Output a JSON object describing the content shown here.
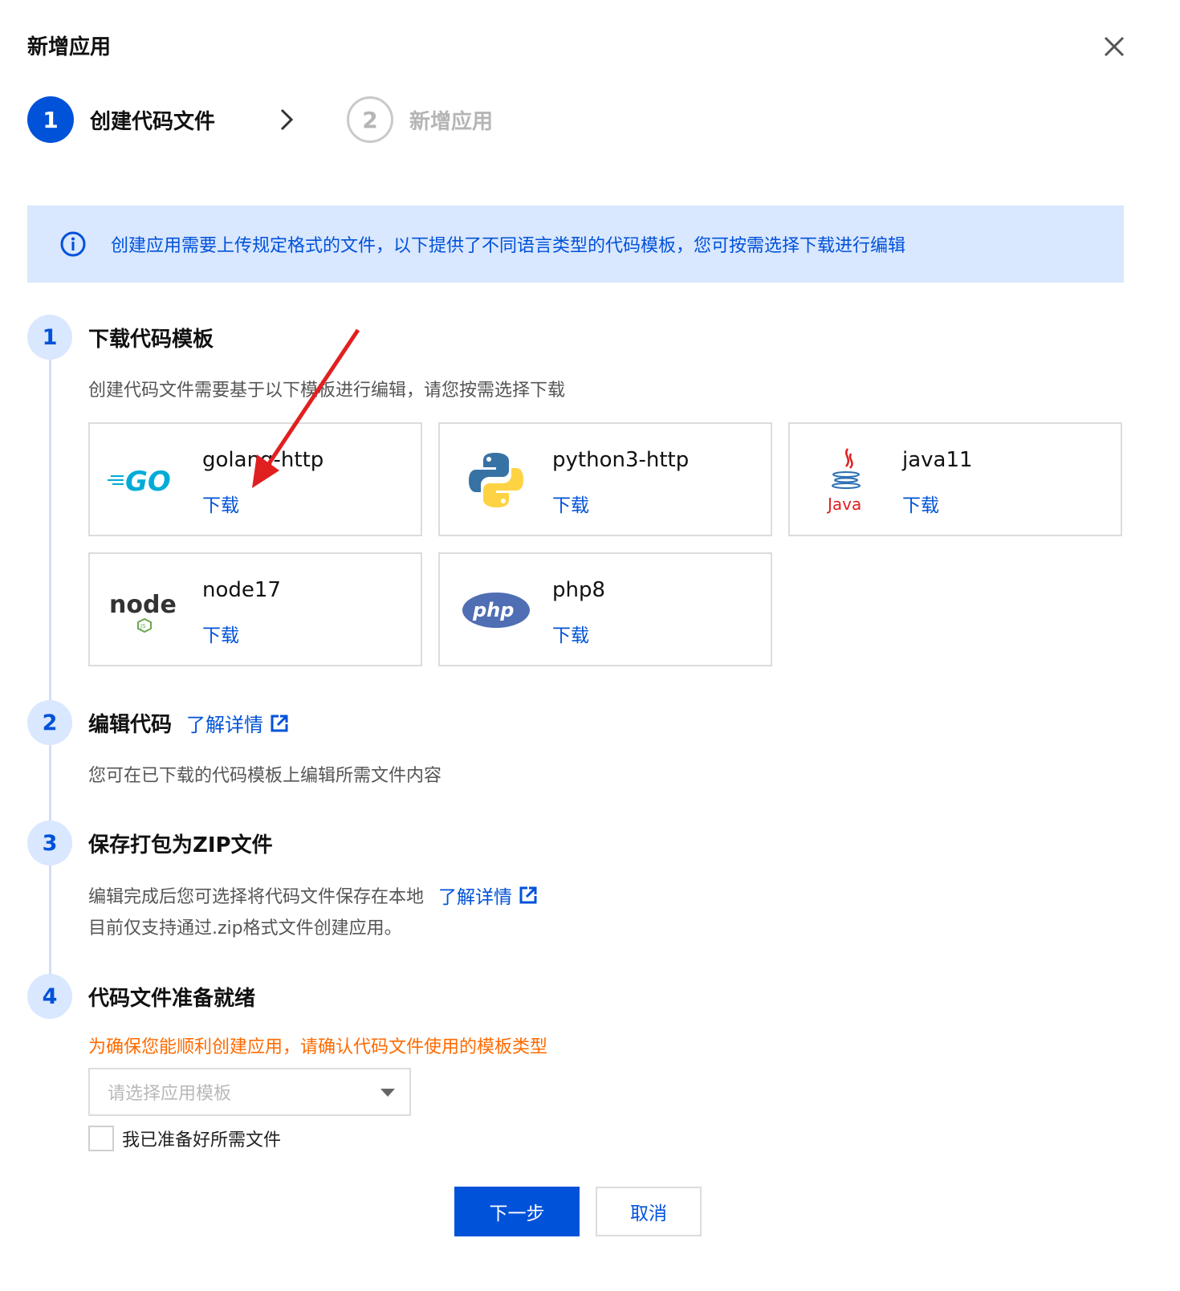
{
  "dialog": {
    "title": "新增应用",
    "close_icon": "close-icon"
  },
  "stepper": {
    "steps": [
      {
        "number": "1",
        "label": "创建代码文件",
        "state": "active"
      },
      {
        "number": "2",
        "label": "新增应用",
        "state": "inactive"
      }
    ]
  },
  "info_banner": {
    "text": "创建应用需要上传规定格式的文件，以下提供了不同语言类型的代码模板，您可按需选择下载进行编辑"
  },
  "sections": [
    {
      "number": "1",
      "title": "下载代码模板",
      "desc": "创建代码文件需要基于以下模板进行编辑，请您按需选择下载"
    },
    {
      "number": "2",
      "title": "编辑代码",
      "link": "了解详情",
      "desc": "您可在已下载的代码模板上编辑所需文件内容"
    },
    {
      "number": "3",
      "title": "保存打包为ZIP文件",
      "desc_line1": "编辑完成后您可选择将代码文件保存在本地",
      "link": "了解详情",
      "desc_line2": "目前仅支持通过.zip格式文件创建应用。"
    },
    {
      "number": "4",
      "title": "代码文件准备就绪"
    }
  ],
  "templates": [
    {
      "name": "golang-http",
      "download": "下载",
      "logo_text": "GO"
    },
    {
      "name": "python3-http",
      "download": "下载"
    },
    {
      "name": "java11",
      "download": "下载",
      "logo_text": "Java"
    },
    {
      "name": "node17",
      "download": "下载",
      "logo_text": "node"
    },
    {
      "name": "php8",
      "download": "下载",
      "logo_text": "php"
    }
  ],
  "form": {
    "warning": "为确保您能顺利创建应用，请确认代码文件使用的模板类型",
    "select_placeholder": "请选择应用模板",
    "checkbox_label": "我已准备好所需文件"
  },
  "buttons": {
    "next": "下一步",
    "cancel": "取消"
  },
  "colors": {
    "primary": "#0052d9",
    "info_bg": "#d9e7ff",
    "warning": "#ff6a00",
    "annotation_arrow": "#e02020"
  }
}
